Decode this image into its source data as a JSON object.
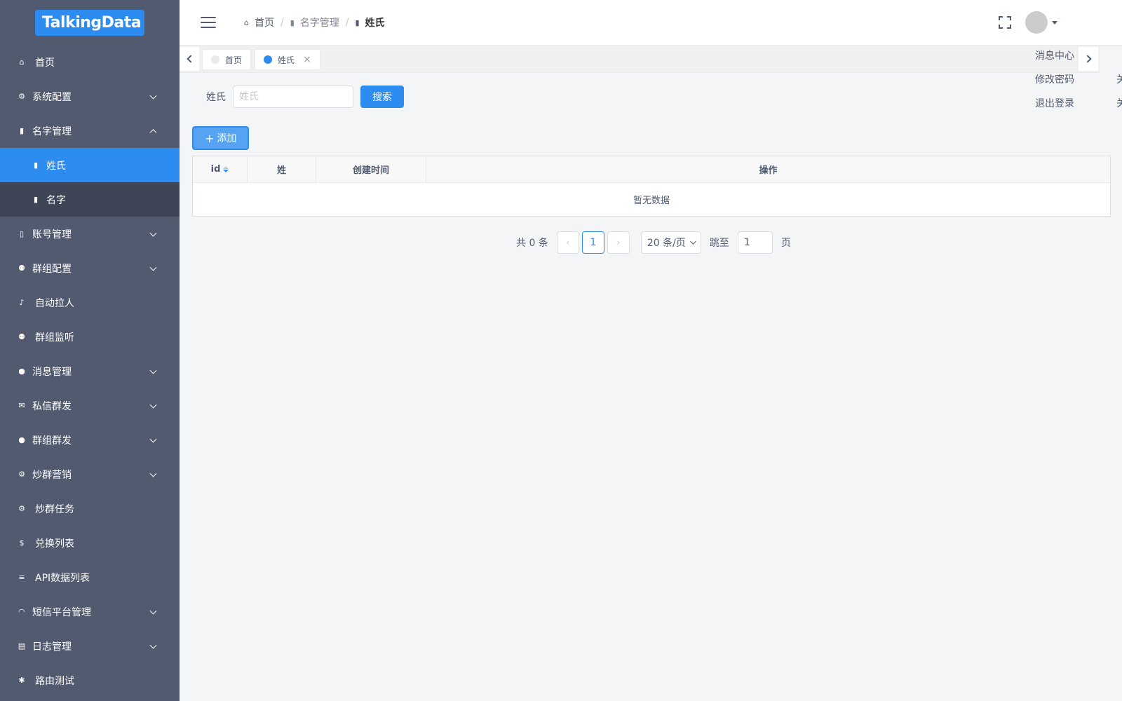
{
  "logo": "TalkingData",
  "sidebar": {
    "items": [
      {
        "label": "首页",
        "icon": "home-icon"
      },
      {
        "label": "系统配置",
        "icon": "gear-icon"
      },
      {
        "label": "名字管理",
        "icon": "book-icon"
      },
      {
        "label": "账号管理",
        "icon": "phone-icon"
      },
      {
        "label": "群组配置",
        "icon": "people-icon"
      },
      {
        "label": "自动拉人",
        "icon": "bell-icon"
      },
      {
        "label": "群组监听",
        "icon": "people-icon"
      },
      {
        "label": "消息管理",
        "icon": "chat-icon"
      },
      {
        "label": "私信群发",
        "icon": "mail-icon"
      },
      {
        "label": "群组群发",
        "icon": "chat-icon"
      },
      {
        "label": "炒群营销",
        "icon": "gear-icon"
      },
      {
        "label": "炒群任务",
        "icon": "gear-icon"
      },
      {
        "label": "兑换列表",
        "icon": "dollar-icon"
      },
      {
        "label": "API数据列表",
        "icon": "list-icon"
      },
      {
        "label": "短信平台管理",
        "icon": "wifi-icon"
      },
      {
        "label": "日志管理",
        "icon": "log-icon"
      },
      {
        "label": "路由测试",
        "icon": "bug-icon"
      }
    ],
    "sub": [
      {
        "label": "姓氏",
        "icon": "book-icon"
      },
      {
        "label": "名字",
        "icon": "book-icon"
      }
    ]
  },
  "breadcrumb": {
    "home": "首页",
    "section": "名字管理",
    "current": "姓氏",
    "sep": "/"
  },
  "tags": [
    {
      "label": "首页"
    },
    {
      "label": "姓氏",
      "close": "×"
    }
  ],
  "dropdown": {
    "items": [
      "消息中心",
      "修改密码",
      "退出登录"
    ],
    "overflow": [
      "关",
      "关"
    ]
  },
  "search": {
    "label": "姓氏",
    "placeholder": "姓氏",
    "button": "搜索"
  },
  "add_button": "添加",
  "table": {
    "columns": [
      "id",
      "姓",
      "创建时间",
      "操作"
    ],
    "empty_text": "暂无数据"
  },
  "pager": {
    "total": "共 0 条",
    "current_page": "1",
    "page_size": "20 条/页",
    "jump_label": "跳至",
    "jump_value": "1",
    "page_suffix": "页"
  },
  "colors": {
    "primary": "#2d8cf0",
    "sidebar": "#515a6e",
    "submenu": "#3e4557"
  }
}
